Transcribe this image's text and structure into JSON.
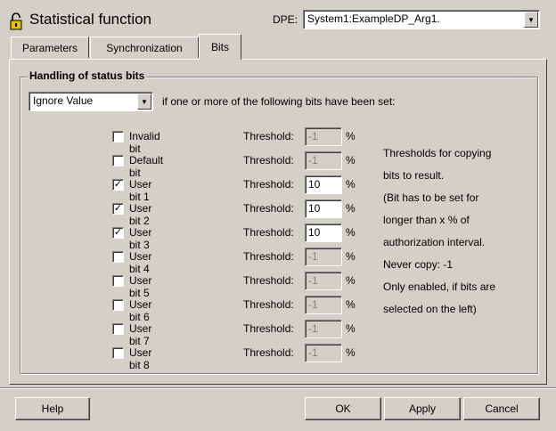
{
  "title": "Statistical function",
  "dpe": {
    "label": "DPE:",
    "value": "System1:ExampleDP_Arg1."
  },
  "tabs": [
    {
      "label": "Parameters",
      "active": false
    },
    {
      "label": "Synchronization",
      "active": false
    },
    {
      "label": "Bits",
      "active": true
    }
  ],
  "group": {
    "title": "Handling of status bits",
    "mode_select": "Ignore Value",
    "mode_suffix": "if one or more of the following bits have been set:"
  },
  "bits": [
    {
      "label": "Invalid bit",
      "checked": false,
      "threshold_label": "Threshold:",
      "threshold": "-1",
      "unit": "%",
      "enabled": false
    },
    {
      "label": "Default bit",
      "checked": false,
      "threshold_label": "Threshold:",
      "threshold": "-1",
      "unit": "%",
      "enabled": false
    },
    {
      "label": "User bit 1",
      "checked": true,
      "threshold_label": "Threshold:",
      "threshold": "10",
      "unit": "%",
      "enabled": true
    },
    {
      "label": "User bit 2",
      "checked": true,
      "threshold_label": "Threshold:",
      "threshold": "10",
      "unit": "%",
      "enabled": true
    },
    {
      "label": "User bit 3",
      "checked": true,
      "threshold_label": "Threshold:",
      "threshold": "10",
      "unit": "%",
      "enabled": true
    },
    {
      "label": "User bit 4",
      "checked": false,
      "threshold_label": "Threshold:",
      "threshold": "-1",
      "unit": "%",
      "enabled": false
    },
    {
      "label": "User bit 5",
      "checked": false,
      "threshold_label": "Threshold:",
      "threshold": "-1",
      "unit": "%",
      "enabled": false
    },
    {
      "label": "User bit 6",
      "checked": false,
      "threshold_label": "Threshold:",
      "threshold": "-1",
      "unit": "%",
      "enabled": false
    },
    {
      "label": "User bit 7",
      "checked": false,
      "threshold_label": "Threshold:",
      "threshold": "-1",
      "unit": "%",
      "enabled": false
    },
    {
      "label": "User bit 8",
      "checked": false,
      "threshold_label": "Threshold:",
      "threshold": "-1",
      "unit": "%",
      "enabled": false
    }
  ],
  "info_lines": [
    "Thresholds for copying",
    "bits to result.",
    "(Bit has to be set for",
    "longer than x % of",
    "authorization interval.",
    "Never copy: -1",
    "Only enabled, if bits are",
    "selected on the left)"
  ],
  "buttons": {
    "help": "Help",
    "ok": "OK",
    "apply": "Apply",
    "cancel": "Cancel"
  }
}
